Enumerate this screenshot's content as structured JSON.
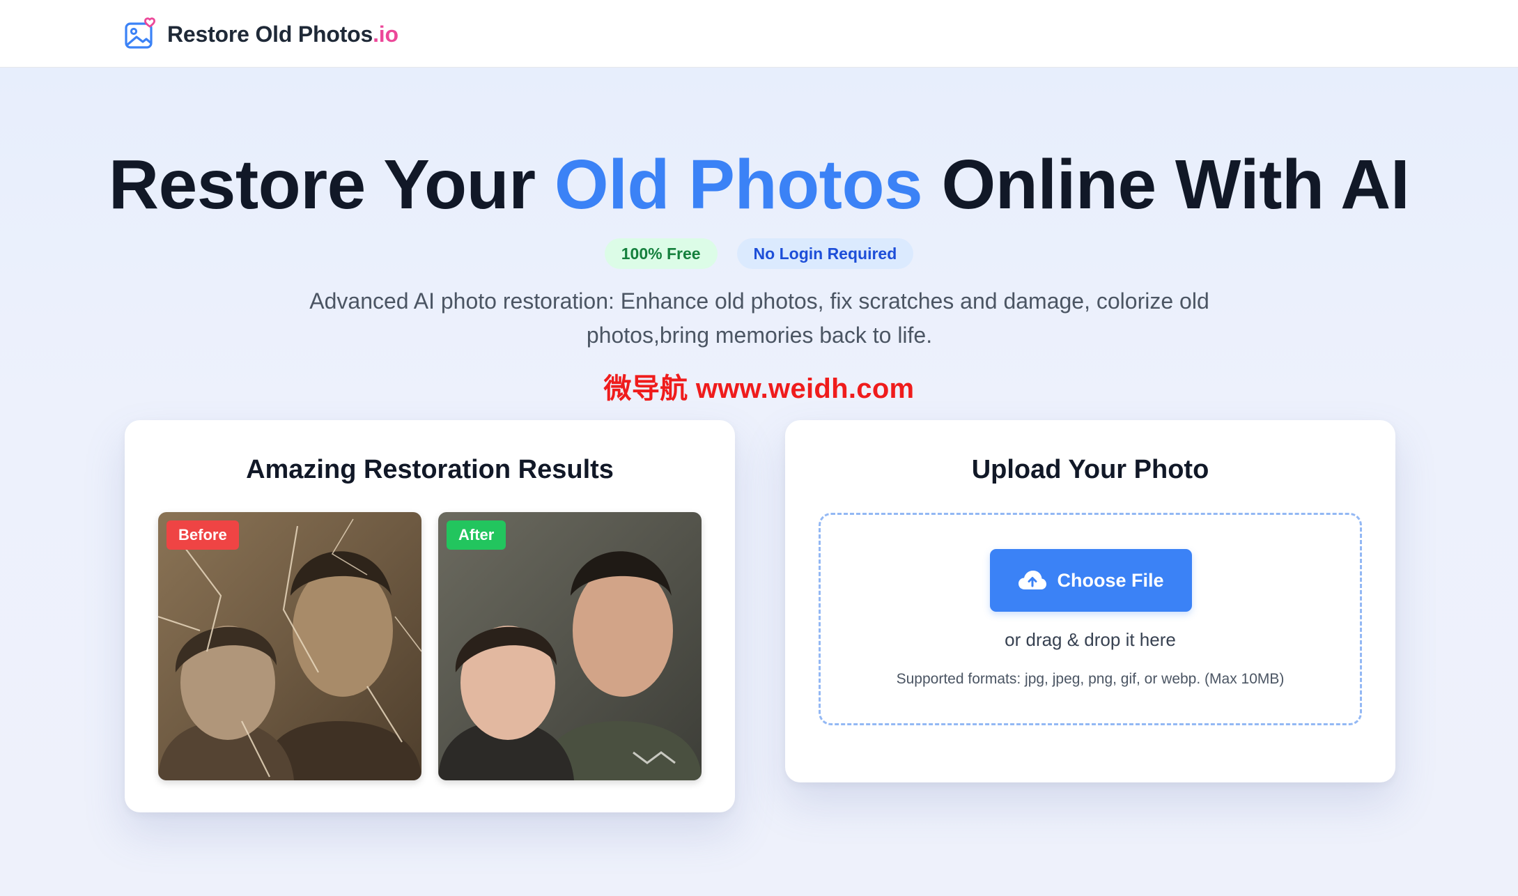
{
  "header": {
    "brand_main": "Restore Old Photos",
    "brand_suffix": ".io",
    "logo_icon": "photo-heart-icon"
  },
  "hero": {
    "title_part1": "Restore Your ",
    "title_accent": "Old Photos",
    "title_part2": " Online With AI",
    "badge_free": "100% Free",
    "badge_login": "No Login Required",
    "subtitle": "Advanced AI photo restoration: Enhance old photos, fix scratches and damage, colorize old photos,bring memories back to life.",
    "watermark": "微导航 www.weidh.com"
  },
  "results_card": {
    "title": "Amazing Restoration Results",
    "before_label": "Before",
    "after_label": "After"
  },
  "upload_card": {
    "title": "Upload Your Photo",
    "button_label": "Choose File",
    "button_icon": "cloud-upload-icon",
    "drag_text": "or drag & drop it here",
    "formats_text": "Supported formats: jpg, jpeg, png, gif, or webp. (Max 10MB)"
  },
  "colors": {
    "accent": "#3b82f6",
    "brand_suffix": "#ec4899",
    "before_tag": "#ef4444",
    "after_tag": "#22c55e"
  }
}
